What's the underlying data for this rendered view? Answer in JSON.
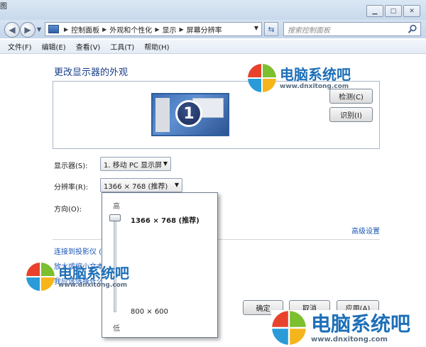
{
  "window": {
    "title_fragment": "图",
    "buttons": [
      "minimize",
      "maximize",
      "close"
    ]
  },
  "address": {
    "crumbs": [
      "控制面板",
      "外观和个性化",
      "显示",
      "屏幕分辨率"
    ],
    "search_placeholder": "搜索控制面板"
  },
  "menu": {
    "items": [
      "文件(F)",
      "编辑(E)",
      "查看(V)",
      "工具(T)",
      "帮助(H)"
    ]
  },
  "main": {
    "heading": "更改显示器的外观",
    "monitor_number": "1",
    "detect_label": "检测(C)",
    "identify_label": "识别(I)",
    "display_label": "显示器(S):",
    "display_value": "1. 移动 PC 显示屏",
    "resolution_label": "分辨率(R):",
    "resolution_value": "1366 × 768 (推荐)",
    "orientation_label": "方向(O):",
    "advanced_link": "高级设置",
    "projector_link": "连接到投影仪 (",
    "text_size_link": "放大或缩小文本",
    "which_settings_link": "我应该选择什么",
    "ok_label": "确定",
    "cancel_label": "取消",
    "apply_label": "应用(A)"
  },
  "slider": {
    "high_label": "高",
    "low_label": "低",
    "max_value": "1366 × 768 (推荐)",
    "min_value": "800 × 600",
    "position": 1.0
  },
  "watermark": {
    "name": "电脑系统吧",
    "url": "www.dnxitong.com",
    "colors": [
      "#e8412c",
      "#7cbf2f",
      "#2a9bd8",
      "#f7b51c"
    ]
  }
}
